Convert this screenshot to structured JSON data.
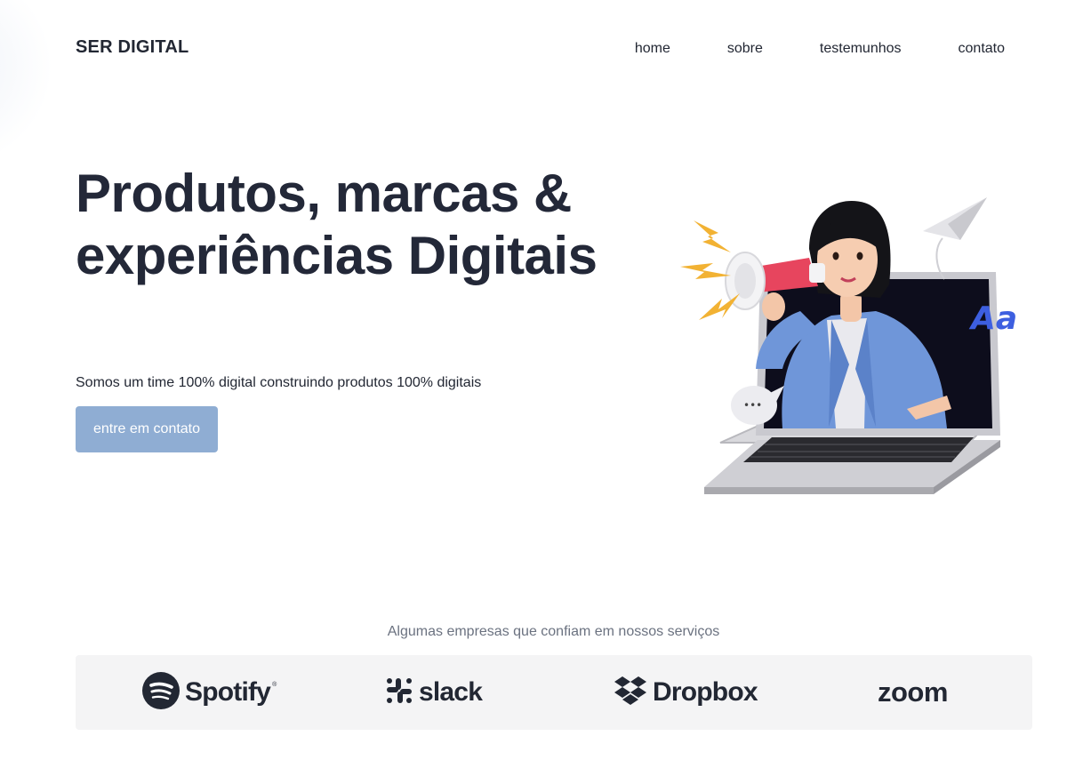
{
  "brand": {
    "name": "SER DIGITAL"
  },
  "nav": {
    "items": [
      {
        "label": "home"
      },
      {
        "label": "sobre"
      },
      {
        "label": "testemunhos"
      },
      {
        "label": "contato"
      }
    ]
  },
  "hero": {
    "title_line1": "Produtos, marcas &",
    "title_line2": "experiências Digitais",
    "subtitle": "Somos um time 100% digital construindo produtos 100% digitais",
    "cta_label": "entre em contato",
    "illustration_badge": "Aa",
    "illustration_bubble": "•••"
  },
  "partners": {
    "caption": "Algumas empresas que confiam em nossos serviços",
    "logos": [
      {
        "name": "Spotify",
        "icon": "spotify-icon"
      },
      {
        "name": "slack",
        "icon": "slack-icon"
      },
      {
        "name": "Dropbox",
        "icon": "dropbox-icon"
      },
      {
        "name": "zoom",
        "icon": ""
      }
    ]
  },
  "colors": {
    "text": "#222733",
    "cta_background": "#8fadd3",
    "strip_background": "#f4f4f5",
    "caption": "#6b7280"
  }
}
